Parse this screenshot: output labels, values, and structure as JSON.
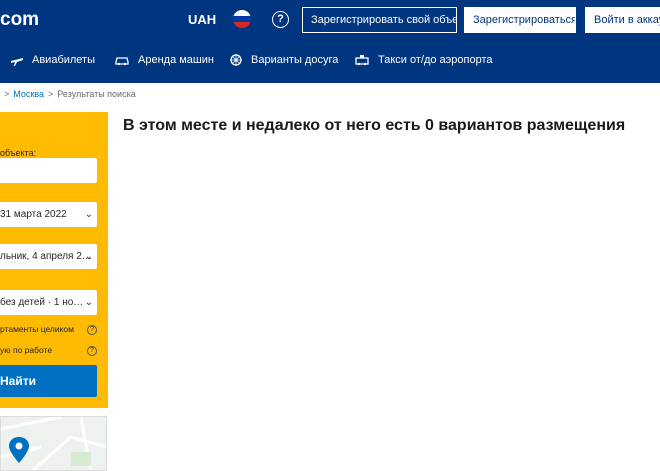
{
  "header": {
    "logo": "com",
    "currency": "UAH",
    "help_icon": "?",
    "list_property": "Зарегистрировать свой объект",
    "register": "Зарегистрироваться",
    "sign_in": "Войти в аккаунт"
  },
  "nav": [
    {
      "label": "Авиабилеты",
      "icon": "plane-icon"
    },
    {
      "label": "Аренда машин",
      "icon": "car-icon"
    },
    {
      "label": "Варианты досуга",
      "icon": "attractions-icon"
    },
    {
      "label": "Такси от/до аэропорта",
      "icon": "taxi-icon"
    }
  ],
  "breadcrumb": {
    "separator": ">",
    "city": "Москва",
    "current": "Результаты поиска"
  },
  "search": {
    "destination_label": "объекта:",
    "destination_value": "",
    "checkin": "31 марта 2022",
    "checkout": "льник, 4 апреля 2…",
    "guests": "без детей · 1 но…",
    "option_apartments": "ртаменты целиком",
    "option_work": "ую по работе",
    "button": "Найти"
  },
  "results": {
    "title": "В этом месте и недалеко от него есть 0 вариантов размещения"
  },
  "colors": {
    "brand": "#003580",
    "accent": "#febb02",
    "button": "#0071c2"
  }
}
